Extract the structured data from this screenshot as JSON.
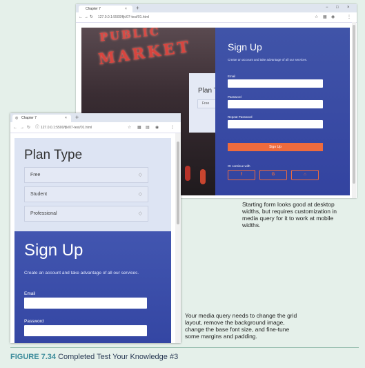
{
  "desktop": {
    "tab_title": "Chapter 7",
    "tab_close": "×",
    "new_tab": "+",
    "url": "127.0.0.1:5500/fjk/07-test/01.html",
    "win_min": "−",
    "win_max": "□",
    "win_close": "×",
    "plan": {
      "title": "Plan Type",
      "items": [
        "Free"
      ]
    },
    "signup": {
      "title": "Sign Up",
      "subtitle": "Create an account and take advantage of all our services.",
      "email_label": "Email",
      "password_label": "Password",
      "repeat_label": "Repeat Password",
      "button": "Sign Up",
      "or_text": "Or continue with",
      "social": [
        "f",
        "G",
        "⌂"
      ]
    },
    "photo_sign": [
      "PUBLIC",
      "MARKET"
    ]
  },
  "mobile": {
    "tab_title": "Chapter 7",
    "tab_close": "×",
    "new_tab": "+",
    "url": "127.0.0.1:5500/fjk/07-test/01.html",
    "plan": {
      "title": "Plan Type",
      "items": [
        "Free",
        "Student",
        "Professional"
      ]
    },
    "signup": {
      "title": "Sign Up",
      "subtitle": "Create an account and take advantage of all our services.",
      "email_label": "Email",
      "password_label": "Password"
    }
  },
  "notes": {
    "desktop_note": [
      "Starting form looks good at desktop",
      "widths, but requires customization in",
      "media query for it to work at mobile",
      "widths."
    ],
    "mobile_note": [
      "Your media query needs to change the grid",
      "layout, remove the background image,",
      "change the base font size, and fine-tune",
      "some margins and padding."
    ]
  },
  "caption": {
    "figure": "FIGURE 7.34",
    "text": "Completed Test Your Knowledge #3"
  },
  "colors": {
    "signup_blue": "#3a4ca6",
    "accent_orange": "#ee6b3d",
    "plan_bg": "#dde4f3"
  }
}
